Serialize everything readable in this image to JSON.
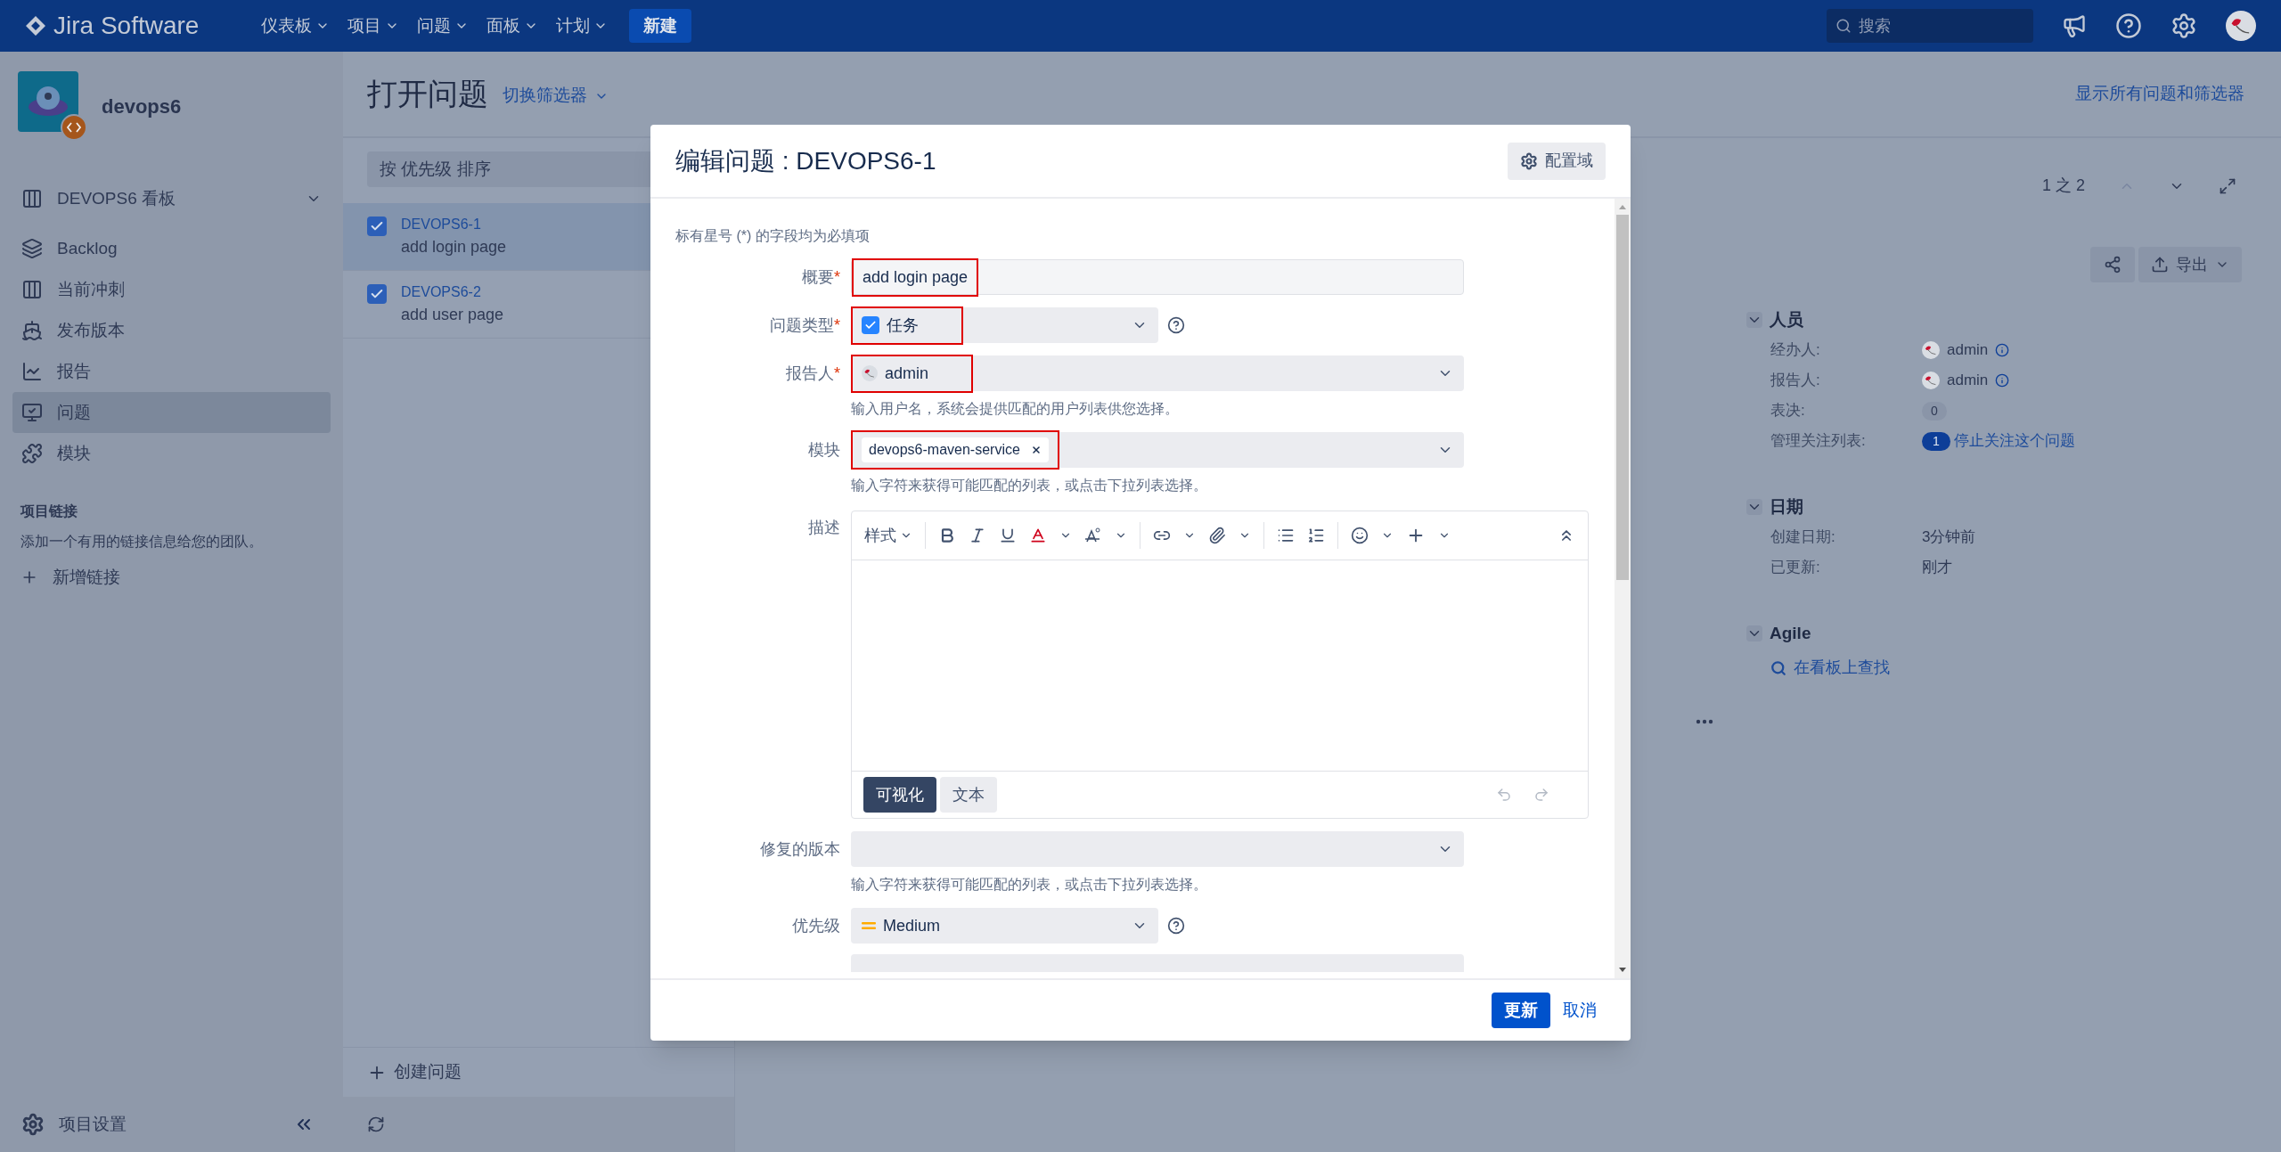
{
  "top_nav": {
    "logo": "Jira Software",
    "menus": [
      {
        "label": "仪表板"
      },
      {
        "label": "项目"
      },
      {
        "label": "问题"
      },
      {
        "label": "面板"
      },
      {
        "label": "计划"
      }
    ],
    "create_button": "新建",
    "search": {
      "placeholder": "搜索"
    }
  },
  "sidebar": {
    "project_name": "devops6",
    "items": [
      {
        "label": "DEVOPS6 看板",
        "selected": false
      },
      {
        "label": "Backlog",
        "selected": false
      },
      {
        "label": "当前冲刺",
        "selected": false
      },
      {
        "label": "发布版本",
        "selected": false
      },
      {
        "label": "报告",
        "selected": false
      },
      {
        "label": "问题",
        "selected": true
      },
      {
        "label": "模块",
        "selected": false
      }
    ],
    "links_title": "项目链接",
    "links_description": "添加一个有用的链接信息给您的团队。",
    "add_link": "新增链接",
    "settings": "项目设置"
  },
  "page_header": {
    "title": "打开问题",
    "filter_switch": "切换筛选器",
    "show_all": "显示所有问题和筛选器"
  },
  "issue_list": {
    "sort": "按 优先级 排序",
    "issues": [
      {
        "key": "DEVOPS6-1",
        "summary": "add login page",
        "selected": true
      },
      {
        "key": "DEVOPS6-2",
        "summary": "add user page",
        "selected": false
      }
    ],
    "create": "创建问题"
  },
  "detail": {
    "pager": "1 之 2",
    "export": "导出",
    "sections": [
      {
        "title": "人员",
        "rows": [
          {
            "kind": "user",
            "label": "经办人:",
            "value": "admin"
          },
          {
            "kind": "user",
            "label": "报告人:",
            "value": "admin"
          },
          {
            "kind": "count",
            "label": "表决:",
            "value": "0"
          },
          {
            "kind": "watch",
            "label": "管理关注列表:",
            "count": "1",
            "value": "停止关注这个问题"
          }
        ]
      },
      {
        "title": "日期",
        "rows": [
          {
            "kind": "text",
            "label": "创建日期:",
            "value": "3分钟前"
          },
          {
            "kind": "text",
            "label": "已更新:",
            "value": "刚才"
          }
        ]
      },
      {
        "title": "Agile",
        "rows": [
          {
            "kind": "link",
            "value": "在看板上查找"
          }
        ]
      }
    ]
  },
  "modal": {
    "title": "编辑问题 : DEVOPS6-1",
    "required_mark": "*",
    "config_button": "配置域",
    "required_note": "标有星号 (*) 的字段均为必填项",
    "fields": [
      {
        "kind": "text",
        "label": "概要",
        "required": true,
        "value": "add login page",
        "highlighted": true
      },
      {
        "kind": "issue-type",
        "label": "问题类型",
        "required": true,
        "value": "任务",
        "highlighted": true
      },
      {
        "kind": "user",
        "label": "报告人",
        "required": true,
        "value": "admin",
        "hint": "输入用户名，系统会提供匹配的用户列表供您选择。",
        "highlighted": true
      },
      {
        "kind": "components",
        "label": "模块",
        "required": false,
        "value": "devops6-maven-service",
        "hint": "输入字符来获得可能匹配的列表，或点击下拉列表选择。",
        "highlighted": true
      },
      {
        "kind": "editor",
        "label": "描述",
        "required": false,
        "style_menu": "样式",
        "modes": [
          {
            "label": "可视化",
            "selected": true
          },
          {
            "label": "文本",
            "selected": false
          }
        ]
      },
      {
        "kind": "select",
        "label": "修复的版本",
        "required": false,
        "hint": "输入字符来获得可能匹配的列表，或点击下拉列表选择。"
      },
      {
        "kind": "priority",
        "label": "优先级",
        "required": false,
        "value": "Medium"
      }
    ],
    "update_button": "更新",
    "cancel_link": "取消"
  }
}
